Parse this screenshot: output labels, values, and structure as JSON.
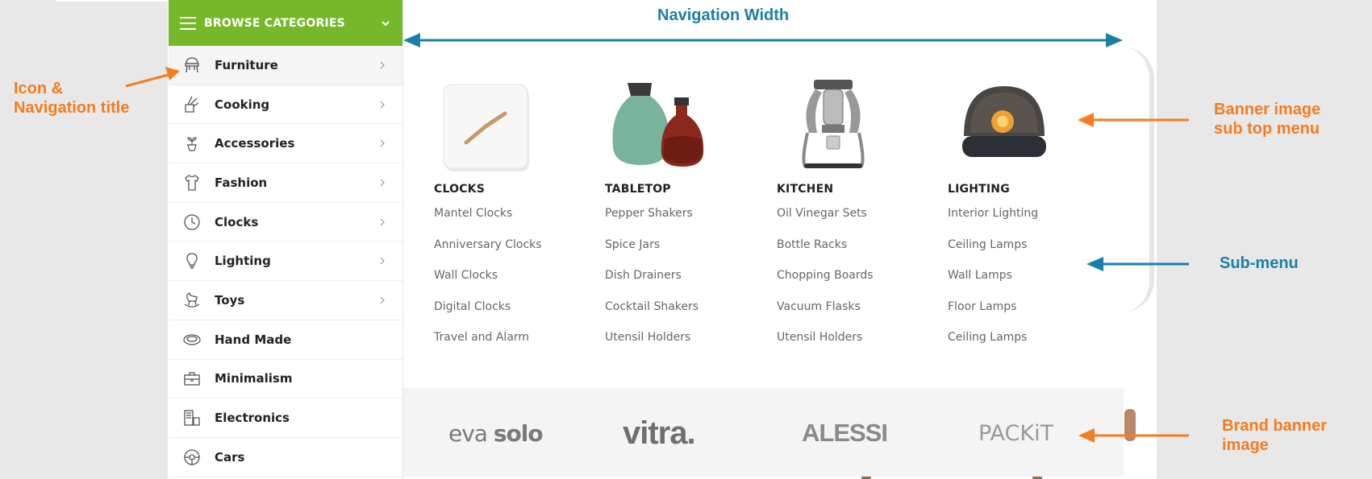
{
  "sidebar": {
    "header_title": "BROWSE CATEGORIES",
    "items": [
      {
        "label": "Furniture",
        "icon": "chair-icon",
        "has_submenu": true,
        "active": true
      },
      {
        "label": "Cooking",
        "icon": "kitchen-utensils-icon",
        "has_submenu": true
      },
      {
        "label": "Accessories",
        "icon": "plant-pot-icon",
        "has_submenu": true
      },
      {
        "label": "Fashion",
        "icon": "shirt-icon",
        "has_submenu": true
      },
      {
        "label": "Clocks",
        "icon": "clock-icon",
        "has_submenu": true
      },
      {
        "label": "Lighting",
        "icon": "light-bulb-icon",
        "has_submenu": true
      },
      {
        "label": "Toys",
        "icon": "rocking-horse-icon",
        "has_submenu": true
      },
      {
        "label": "Hand Made",
        "icon": "yarn-bowl-icon",
        "has_submenu": false
      },
      {
        "label": "Minimalism",
        "icon": "briefcase-icon",
        "has_submenu": false
      },
      {
        "label": "Electronics",
        "icon": "devices-icon",
        "has_submenu": false
      },
      {
        "label": "Cars",
        "icon": "steering-wheel-icon",
        "has_submenu": false
      }
    ]
  },
  "mega_menu": {
    "columns": [
      {
        "title": "CLOCKS",
        "image": "clock-product-image",
        "links": [
          "Mantel Clocks",
          "Anniversary Clocks",
          "Wall Clocks",
          "Digital Clocks",
          "Travel and Alarm"
        ]
      },
      {
        "title": "TABLETOP",
        "image": "carafe-product-image",
        "links": [
          "Pepper Shakers",
          "Spice Jars",
          "Dish Drainers",
          "Cocktail Shakers",
          "Utensil Holders"
        ]
      },
      {
        "title": "KITCHEN",
        "image": "espresso-maker-product-image",
        "links": [
          "Oil Vinegar Sets",
          "Bottle Racks",
          "Chopping Boards",
          "Vacuum Flasks",
          "Utensil Holders"
        ]
      },
      {
        "title": "LIGHTING",
        "image": "lamp-product-image",
        "links": [
          "Interior Lighting",
          "Ceiling Lamps",
          "Wall Lamps",
          "Floor Lamps",
          "Ceiling Lamps"
        ]
      }
    ],
    "brands": [
      {
        "name_a": "eva",
        "name_b": "solo"
      },
      {
        "name": "vitra."
      },
      {
        "name": "ALESSI"
      },
      {
        "name": "PACKiT"
      }
    ]
  },
  "annotations": {
    "icon_title": "Icon &\nNavigation title",
    "icon_title_line1": "Icon &",
    "icon_title_line2": "Navigation title",
    "nav_width": "Navigation Width",
    "banner_line1": "Banner image",
    "banner_line2": "sub top menu",
    "submenu": "Sub-menu",
    "brand_line1": "Brand banner",
    "brand_line2": "image"
  },
  "colors": {
    "accent_green": "#76b82a",
    "annotation_orange": "#f57c1f",
    "annotation_blue": "#1a7fa8"
  }
}
